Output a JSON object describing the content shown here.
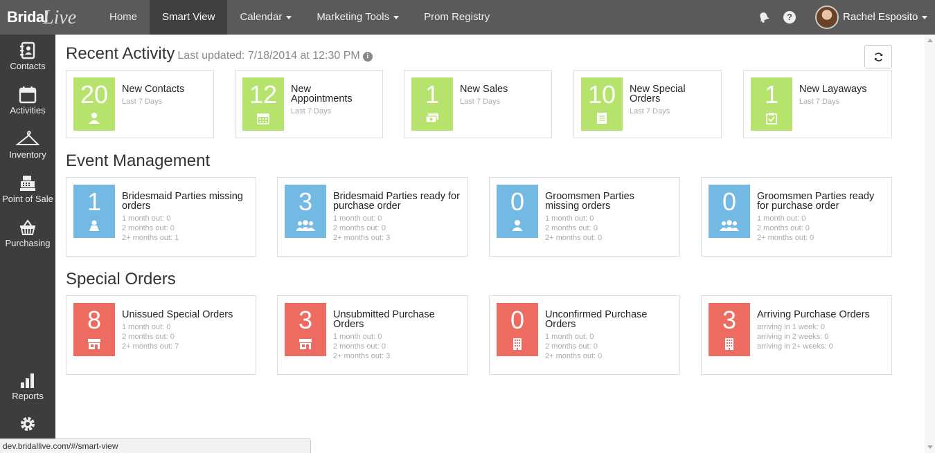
{
  "app": {
    "logo_part1": "Bridal",
    "logo_part2": "Live"
  },
  "nav": {
    "home": "Home",
    "smart_view": "Smart View",
    "calendar": "Calendar",
    "marketing": "Marketing Tools",
    "prom": "Prom Registry"
  },
  "user": {
    "name": "Rachel Esposito",
    "help": "?"
  },
  "sidebar": {
    "contacts": "Contacts",
    "activities": "Activities",
    "inventory": "Inventory",
    "pos": "Point of Sale",
    "purchasing": "Purchasing",
    "reports": "Reports"
  },
  "recent": {
    "title": "Recent Activity",
    "updated": "Last updated: 7/18/2014 at 12:30 PM",
    "cards": [
      {
        "num": "20",
        "title": "New Contacts",
        "sub": "Last 7 Days",
        "icon": "user-icon"
      },
      {
        "num": "12",
        "title": "New Appointments",
        "sub": "Last 7 Days",
        "icon": "calendar-icon"
      },
      {
        "num": "1",
        "title": "New Sales",
        "sub": "Last 7 Days",
        "icon": "money-icon"
      },
      {
        "num": "10",
        "title": "New Special Orders",
        "sub": "Last 7 Days",
        "icon": "document-icon"
      },
      {
        "num": "1",
        "title": "New Layaways",
        "sub": "Last 7 Days",
        "icon": "clipboard-icon"
      }
    ]
  },
  "events": {
    "title": "Event Management",
    "cards": [
      {
        "num": "1",
        "title": "Bridesmaid Parties missing orders",
        "l1": "1 month out: 0",
        "l2": "2 months out: 0",
        "l3": "2+ months out: 1",
        "icon": "bridesmaid-icon"
      },
      {
        "num": "3",
        "title": "Bridesmaid Parties ready for purchase order",
        "l1": "1 month out: 0",
        "l2": "2 months out: 0",
        "l3": "2+ months out: 3",
        "icon": "group-icon"
      },
      {
        "num": "0",
        "title": "Groomsmen Parties missing orders",
        "l1": "1 month out: 0",
        "l2": "2 months out: 0",
        "l3": "2+ months out: 0",
        "icon": "groomsman-icon"
      },
      {
        "num": "0",
        "title": "Groomsmen Parties ready for purchase order",
        "l1": "1 month out: 0",
        "l2": "2 months out: 0",
        "l3": "2+ months out: 0",
        "icon": "group-icon"
      }
    ]
  },
  "special": {
    "title": "Special Orders",
    "cards": [
      {
        "num": "8",
        "title": "Unissued Special Orders",
        "l1": "1 month out: 0",
        "l2": "2 months out: 0",
        "l3": "2+ months out: 7",
        "icon": "store-icon"
      },
      {
        "num": "3",
        "title": "Unsubmitted Purchase Orders",
        "l1": "1 month out: 0",
        "l2": "2 months out: 0",
        "l3": "2+ months out: 3",
        "icon": "store-icon"
      },
      {
        "num": "0",
        "title": "Unconfirmed Purchase Orders",
        "l1": "1 month out: 0",
        "l2": "2 months out: 0",
        "l3": "2+ months out: 0",
        "icon": "building-icon"
      },
      {
        "num": "3",
        "title": "Arriving Purchase Orders",
        "l1": "arriving in 1 week: 0",
        "l2": "arriving in 2 weeks: 0",
        "l3": "arriving in 2+ weeks: 0",
        "icon": "building-icon"
      }
    ]
  },
  "status_url": "dev.bridallive.com/#/smart-view",
  "colors": {
    "green": "#b5e36c",
    "blue": "#72b9e3",
    "red": "#ee6b62",
    "topbar": "#5a5a5a",
    "sidebar": "#3d3d3d"
  }
}
